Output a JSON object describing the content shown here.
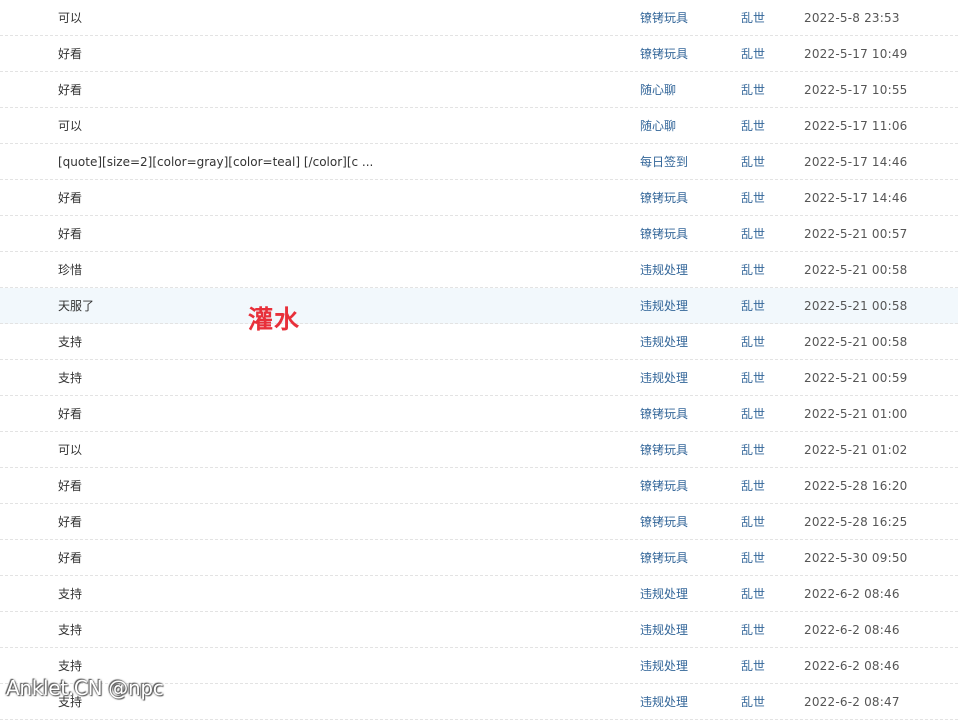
{
  "posts": [
    {
      "subject": "可以",
      "forum": "镣铐玩具",
      "author": "乱世",
      "time": "2022-5-8 23:53"
    },
    {
      "subject": "好看",
      "forum": "镣铐玩具",
      "author": "乱世",
      "time": "2022-5-17 10:49"
    },
    {
      "subject": "好看",
      "forum": "随心聊",
      "author": "乱世",
      "time": "2022-5-17 10:55"
    },
    {
      "subject": "可以",
      "forum": "随心聊",
      "author": "乱世",
      "time": "2022-5-17 11:06"
    },
    {
      "subject": "[quote][size=2][color=gray][color=teal] [/color][c ...",
      "forum": "每日签到",
      "author": "乱世",
      "time": "2022-5-17 14:46"
    },
    {
      "subject": "好看",
      "forum": "镣铐玩具",
      "author": "乱世",
      "time": "2022-5-17 14:46"
    },
    {
      "subject": "好看",
      "forum": "镣铐玩具",
      "author": "乱世",
      "time": "2022-5-21 00:57"
    },
    {
      "subject": "珍惜",
      "forum": "违规处理",
      "author": "乱世",
      "time": "2022-5-21 00:58"
    },
    {
      "subject": "天服了",
      "forum": "违规处理",
      "author": "乱世",
      "time": "2022-5-21 00:58"
    },
    {
      "subject": "支持",
      "forum": "违规处理",
      "author": "乱世",
      "time": "2022-5-21 00:58"
    },
    {
      "subject": "支持",
      "forum": "违规处理",
      "author": "乱世",
      "time": "2022-5-21 00:59"
    },
    {
      "subject": "好看",
      "forum": "镣铐玩具",
      "author": "乱世",
      "time": "2022-5-21 01:00"
    },
    {
      "subject": "可以",
      "forum": "镣铐玩具",
      "author": "乱世",
      "time": "2022-5-21 01:02"
    },
    {
      "subject": "好看",
      "forum": "镣铐玩具",
      "author": "乱世",
      "time": "2022-5-28 16:20"
    },
    {
      "subject": "好看",
      "forum": "镣铐玩具",
      "author": "乱世",
      "time": "2022-5-28 16:25"
    },
    {
      "subject": "好看",
      "forum": "镣铐玩具",
      "author": "乱世",
      "time": "2022-5-30 09:50"
    },
    {
      "subject": "支持",
      "forum": "违规处理",
      "author": "乱世",
      "time": "2022-6-2 08:46"
    },
    {
      "subject": "支持",
      "forum": "违规处理",
      "author": "乱世",
      "time": "2022-6-2 08:46"
    },
    {
      "subject": "支持",
      "forum": "违规处理",
      "author": "乱世",
      "time": "2022-6-2 08:46"
    },
    {
      "subject": "支持",
      "forum": "违规处理",
      "author": "乱世",
      "time": "2022-6-2 08:47"
    }
  ],
  "highlighted_row": 8,
  "annotation": {
    "text": "灌水",
    "color": "#e8303a"
  },
  "watermark": {
    "text": "Anklet.CN @npc"
  },
  "colors": {
    "link": "#336699",
    "row_hover": "#f2f8fc",
    "row_divider": "#e3e3e3"
  }
}
